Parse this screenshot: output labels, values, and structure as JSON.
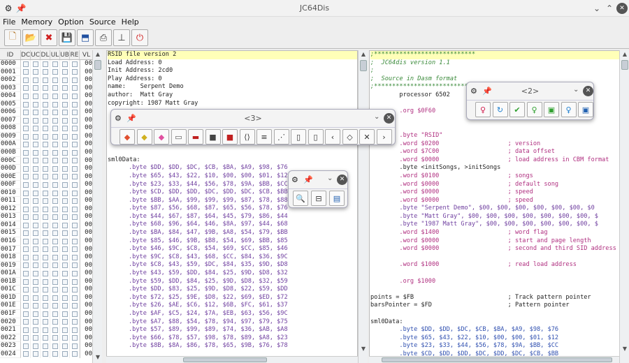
{
  "window": {
    "title": "JC64Dis"
  },
  "menu": [
    "File",
    "Memory",
    "Option",
    "Source",
    "Help"
  ],
  "toolbar": {
    "buttons": [
      {
        "name": "new-file-icon",
        "glyph": "🗋",
        "color": "#b07020"
      },
      {
        "name": "open-folder-icon",
        "glyph": "📂",
        "color": "#2060b0"
      },
      {
        "name": "close-red-icon",
        "glyph": "✖",
        "color": "#d02020"
      },
      {
        "name": "save-icon",
        "glyph": "💾",
        "color": "#3050a0"
      },
      {
        "name": "export-icon",
        "glyph": "⬒",
        "color": "#2050a0"
      },
      {
        "name": "print-icon",
        "glyph": "⎙",
        "color": "#333"
      },
      {
        "name": "pin-tool-icon",
        "glyph": "⊥",
        "color": "#333"
      },
      {
        "name": "power-icon",
        "glyph": "⏻",
        "color": "#d02020"
      }
    ]
  },
  "memory_table": {
    "headers": [
      "ID",
      "DC",
      "UC",
      "DL",
      "UL",
      "UB",
      "RE",
      "VL"
    ],
    "rows": [
      {
        "id": "0000",
        "vl": "00"
      },
      {
        "id": "0001",
        "vl": "00"
      },
      {
        "id": "0002",
        "vl": "00"
      },
      {
        "id": "0003",
        "vl": "00"
      },
      {
        "id": "0004",
        "vl": "00"
      },
      {
        "id": "0005",
        "vl": "00"
      },
      {
        "id": "0006",
        "vl": "00"
      },
      {
        "id": "0007",
        "vl": "00"
      },
      {
        "id": "0008",
        "vl": "00"
      },
      {
        "id": "0009",
        "vl": "00"
      },
      {
        "id": "000A",
        "vl": "00"
      },
      {
        "id": "000B",
        "vl": "00"
      },
      {
        "id": "000C",
        "vl": "00"
      },
      {
        "id": "000D",
        "vl": "00"
      },
      {
        "id": "000E",
        "vl": "00"
      },
      {
        "id": "000F",
        "vl": "00"
      },
      {
        "id": "0010",
        "vl": "00"
      },
      {
        "id": "0011",
        "vl": "00"
      },
      {
        "id": "0012",
        "vl": "00"
      },
      {
        "id": "0013",
        "vl": "00"
      },
      {
        "id": "0014",
        "vl": "00"
      },
      {
        "id": "0015",
        "vl": "00"
      },
      {
        "id": "0016",
        "vl": "00"
      },
      {
        "id": "0017",
        "vl": "00"
      },
      {
        "id": "0018",
        "vl": "00"
      },
      {
        "id": "0019",
        "vl": "00"
      },
      {
        "id": "001A",
        "vl": "00"
      },
      {
        "id": "001B",
        "vl": "00"
      },
      {
        "id": "001C",
        "vl": "00"
      },
      {
        "id": "001D",
        "vl": "00"
      },
      {
        "id": "001E",
        "vl": "00"
      },
      {
        "id": "001F",
        "vl": "00"
      },
      {
        "id": "0020",
        "vl": "00"
      },
      {
        "id": "0021",
        "vl": "00"
      },
      {
        "id": "0022",
        "vl": "00"
      },
      {
        "id": "0023",
        "vl": "00"
      },
      {
        "id": "0024",
        "vl": "00"
      }
    ]
  },
  "middle_listing": {
    "header_lines": [
      "RSID file version 2",
      "Load Address: 0",
      "Init Address: 2cd0",
      "Play Address: 0",
      "name:    Serpent Demo",
      "author:  Matt Gray",
      "copyright: 1987 Matt Gray"
    ],
    "label": "sml0Data:",
    "byte_lines": [
      ".byte $DD, $DD, $DC, $CB, $BA, $A9, $98, $76",
      ".byte $65, $43, $22, $10, $00, $00, $01, $12",
      ".byte $23, $33, $44, $56, $78, $9A, $BB, $CC",
      ".byte $CD, $DD, $DD, $DC, $DD, $DC, $CB, $BB",
      ".byte $BB, $AA, $99, $99, $99, $87, $78, $88",
      ".byte $87, $56, $68, $87, $65, $56, $78, $76",
      ".byte $44, $67, $87, $64, $45, $79, $86, $44",
      ".byte $68, $96, $64, $46, $8A, $97, $44, $68",
      ".byte $BA, $84, $47, $9B, $A8, $54, $79, $BB",
      ".byte $85, $46, $9B, $B8, $54, $69, $BB, $85",
      ".byte $46, $9C, $C8, $54, $69, $CC, $85, $46",
      ".byte $9C, $C8, $43, $68, $CC, $84, $36, $9C",
      ".byte $C8, $43, $59, $DC, $84, $35, $9D, $D8",
      ".byte $43, $59, $DD, $84, $25, $9D, $D8, $32",
      ".byte $59, $DD, $84, $25, $9D, $D8, $32, $59",
      ".byte $DD, $83, $25, $9D, $D8, $22, $59, $DD",
      ".byte $72, $25, $9E, $D8, $22, $69, $ED, $72",
      ".byte $26, $AE, $C6, $12, $6B, $FC, $61, $37",
      ".byte $AF, $C5, $24, $7A, $EB, $63, $56, $9C",
      ".byte $A7, $88, $54, $78, $94, $97, $79, $75",
      ".byte $57, $89, $99, $89, $74, $36, $AB, $A8",
      ".byte $66, $78, $57, $98, $78, $89, $A8, $23",
      ".byte $8B, $8A, $86, $78, $65, $9B, $76, $78"
    ]
  },
  "right_listing": {
    "lines": [
      {
        "c": "green",
        "t": ";****************************",
        "hl": true
      },
      {
        "c": "green",
        "t": ";  JC64dis version 1.1"
      },
      {
        "c": "green",
        "t": ";"
      },
      {
        "c": "green",
        "t": ";  Source in Dasm format"
      },
      {
        "c": "green",
        "t": ";****************************"
      },
      {
        "c": "black",
        "t": "        processor 6502"
      },
      {
        "c": "black",
        "t": ""
      },
      {
        "c": "pink",
        "t": "        .org $0F60"
      },
      {
        "c": "black",
        "t": ""
      },
      {
        "c": "black",
        "t": ""
      },
      {
        "c": "pink",
        "t": "        .byte \"RSID\""
      },
      {
        "c": "pink",
        "t": "        .word $0200                   ; version"
      },
      {
        "c": "pink",
        "t": "        .word $7C00                   ; data offset"
      },
      {
        "c": "pink",
        "t": "        .word $0000                   ; load address in CBM format"
      },
      {
        "c": "black",
        "t": "        .byte <initSongs, >initSongs"
      },
      {
        "c": "pink",
        "t": "        .word $0100                   ; songs"
      },
      {
        "c": "pink",
        "t": "        .word $0000                   ; default song"
      },
      {
        "c": "pink",
        "t": "        .word $0000                   ; speed"
      },
      {
        "c": "pink",
        "t": "        .word $0000                   ; speed"
      },
      {
        "c": "purple",
        "t": "        .byte \"Serpent Demo\", $00, $00, $00, $00, $00, $00, $0"
      },
      {
        "c": "purple",
        "t": "        .byte \"Matt Gray\", $00, $00, $00, $00, $00, $00, $00, $"
      },
      {
        "c": "purple",
        "t": "        .byte \"1987 Matt Gray\", $00, $00, $00, $00, $00, $00, $"
      },
      {
        "c": "pink",
        "t": "        .word $1400                   ; word flag"
      },
      {
        "c": "pink",
        "t": "        .word $0000                   ; start and page length"
      },
      {
        "c": "pink",
        "t": "        .word $0000                   ; second and third SID address"
      },
      {
        "c": "black",
        "t": ""
      },
      {
        "c": "pink",
        "t": "        .word $1000                   ; read load address"
      },
      {
        "c": "black",
        "t": ""
      },
      {
        "c": "pink",
        "t": "        .org $1000"
      },
      {
        "c": "black",
        "t": ""
      },
      {
        "c": "black",
        "t": "points = $FB                          ; Track pattern pointer"
      },
      {
        "c": "black",
        "t": "barsPointer = $FD                     ; Pattern pointer"
      },
      {
        "c": "black",
        "t": ""
      },
      {
        "c": "black",
        "t": "sml0Data:"
      },
      {
        "c": "blue",
        "t": "        .byte $DD, $DD, $DC, $CB, $BA, $A9, $98, $76"
      },
      {
        "c": "blue",
        "t": "        .byte $65, $43, $22, $10, $00, $00, $01, $12"
      },
      {
        "c": "blue",
        "t": "        .byte $23, $33, $44, $56, $78, $9A, $BB, $CC"
      },
      {
        "c": "blue",
        "t": "        .byte $CD, $DD, $DD, $DC, $DD, $DC, $CB, $BB"
      }
    ]
  },
  "panel3": {
    "title": "<3>",
    "buttons": [
      {
        "name": "eraser-orange-icon",
        "glyph": "◆",
        "color": "#e05030"
      },
      {
        "name": "eraser-yellow-icon",
        "glyph": "◆",
        "color": "#d0b020"
      },
      {
        "name": "eraser-pink-icon",
        "glyph": "◆",
        "color": "#e050a0"
      },
      {
        "name": "comment-icon",
        "glyph": "▭",
        "color": "#555"
      },
      {
        "name": "comment-red-icon",
        "glyph": "▬",
        "color": "#c02020"
      },
      {
        "name": "block-dark-icon",
        "glyph": "■",
        "color": "#444"
      },
      {
        "name": "block-red-icon",
        "glyph": "■",
        "color": "#c02020"
      },
      {
        "name": "code-file-icon",
        "glyph": "⟨⟩",
        "color": "#333"
      },
      {
        "name": "list-file-icon",
        "glyph": "≡",
        "color": "#333"
      },
      {
        "name": "dotted-file-icon",
        "glyph": "⋰",
        "color": "#333"
      },
      {
        "name": "file-bar-icon",
        "glyph": "▯",
        "color": "#333"
      },
      {
        "name": "file-blank-icon",
        "glyph": "▯",
        "color": "#333"
      },
      {
        "name": "file-left-icon",
        "glyph": "‹",
        "color": "#333"
      },
      {
        "name": "file-diamond-icon",
        "glyph": "◇",
        "color": "#333"
      },
      {
        "name": "file-cross-icon",
        "glyph": "✕",
        "color": "#333"
      },
      {
        "name": "file-right-icon",
        "glyph": "›",
        "color": "#333"
      }
    ]
  },
  "panel2": {
    "title": "<2>",
    "buttons": [
      {
        "name": "pin-red-icon",
        "glyph": "♀",
        "color": "#d02050"
      },
      {
        "name": "refresh-icon",
        "glyph": "↻",
        "color": "#2080d0"
      },
      {
        "name": "check-icon",
        "glyph": "✔",
        "color": "#30a030"
      },
      {
        "name": "pin-green-icon",
        "glyph": "♀",
        "color": "#30a030"
      },
      {
        "name": "save-green-icon",
        "glyph": "▣",
        "color": "#30a030"
      },
      {
        "name": "pin-blue-icon",
        "glyph": "♀",
        "color": "#2080d0"
      },
      {
        "name": "save-blue-icon",
        "glyph": "▣",
        "color": "#2060b0"
      }
    ]
  },
  "panel_small": {
    "buttons": [
      {
        "name": "search-tool-icon",
        "glyph": "🔍",
        "color": "#c08020"
      },
      {
        "name": "tag-icon",
        "glyph": "⊟",
        "color": "#333"
      },
      {
        "name": "window-icon",
        "glyph": "▤",
        "color": "#2060b0"
      }
    ]
  }
}
